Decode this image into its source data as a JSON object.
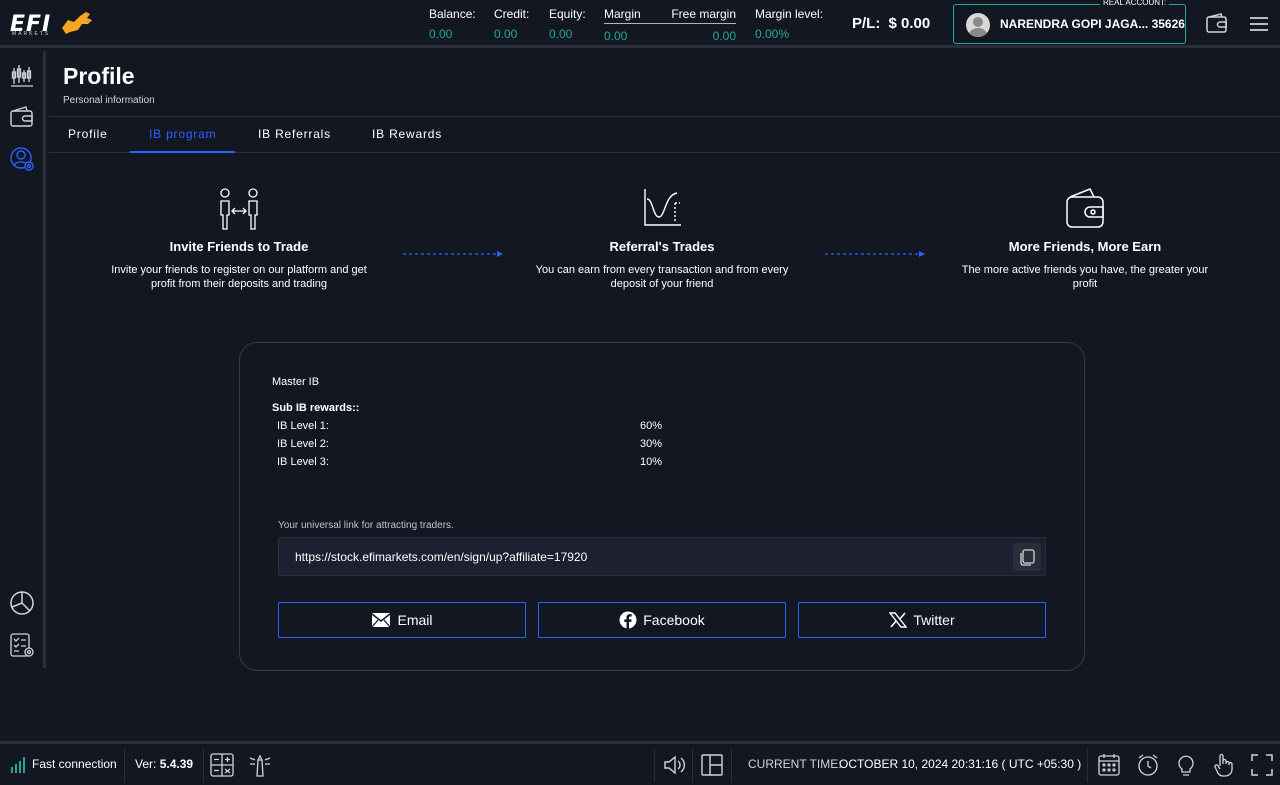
{
  "header": {
    "logo_text": "EFI",
    "logo_sub": "MARKETS",
    "balance_label": "Balance:",
    "balance_value": "0.00",
    "credit_label": "Credit:",
    "credit_value": "0.00",
    "equity_label": "Equity:",
    "equity_value": "0.00",
    "margin_label": "Margin",
    "margin_value": "0.00",
    "free_margin_label": "Free margin",
    "free_margin_value": "0.00",
    "margin_level_label": "Margin level:",
    "margin_level_value": "0.00%",
    "pl_label": "P/L:",
    "pl_value": "$ 0.00",
    "account_type": "REAL ACCOUNT:",
    "account_name": "NARENDRA GOPI JAGA... 35626"
  },
  "page": {
    "title": "Profile",
    "subtitle": "Personal information"
  },
  "tabs": [
    {
      "label": "Profile"
    },
    {
      "label": "IB program"
    },
    {
      "label": "IB Referrals"
    },
    {
      "label": "IB Rewards"
    }
  ],
  "features": [
    {
      "title": "Invite Friends to Trade",
      "desc_line1": "Invite your friends to register on our platform and get",
      "desc_line2": "profit from their deposits and trading"
    },
    {
      "title": "Referral's Trades",
      "desc_line1": "You can earn from every transaction and from every",
      "desc_line2": "deposit of your friend"
    },
    {
      "title": "More Friends, More Earn",
      "desc_line1": "The more active friends you have, the greater your",
      "desc_line2": "profit"
    }
  ],
  "ib": {
    "master_label": "Master IB",
    "sub_rewards_label": "Sub IB rewards::",
    "levels": [
      {
        "label": "IB Level 1:",
        "value": "60%"
      },
      {
        "label": "IB Level 2:",
        "value": "30%"
      },
      {
        "label": "IB Level 3:",
        "value": "10%"
      }
    ],
    "link_label": "Your universal link for attracting traders.",
    "link_url": "https://stock.efimarkets.com/en/sign/up?affiliate=17920"
  },
  "share": {
    "email": "Email",
    "facebook": "Facebook",
    "twitter": "Twitter"
  },
  "footer": {
    "connection": "Fast connection",
    "version_label": "Ver:",
    "version_value": "5.4.39",
    "time_label": "CURRENT TIME:",
    "time_value": "OCTOBER 10, 2024 20:31:16 ( UTC +05:30 )"
  },
  "colors": {
    "accent": "#2962ff",
    "positive": "#26a69a",
    "background": "#131722"
  }
}
